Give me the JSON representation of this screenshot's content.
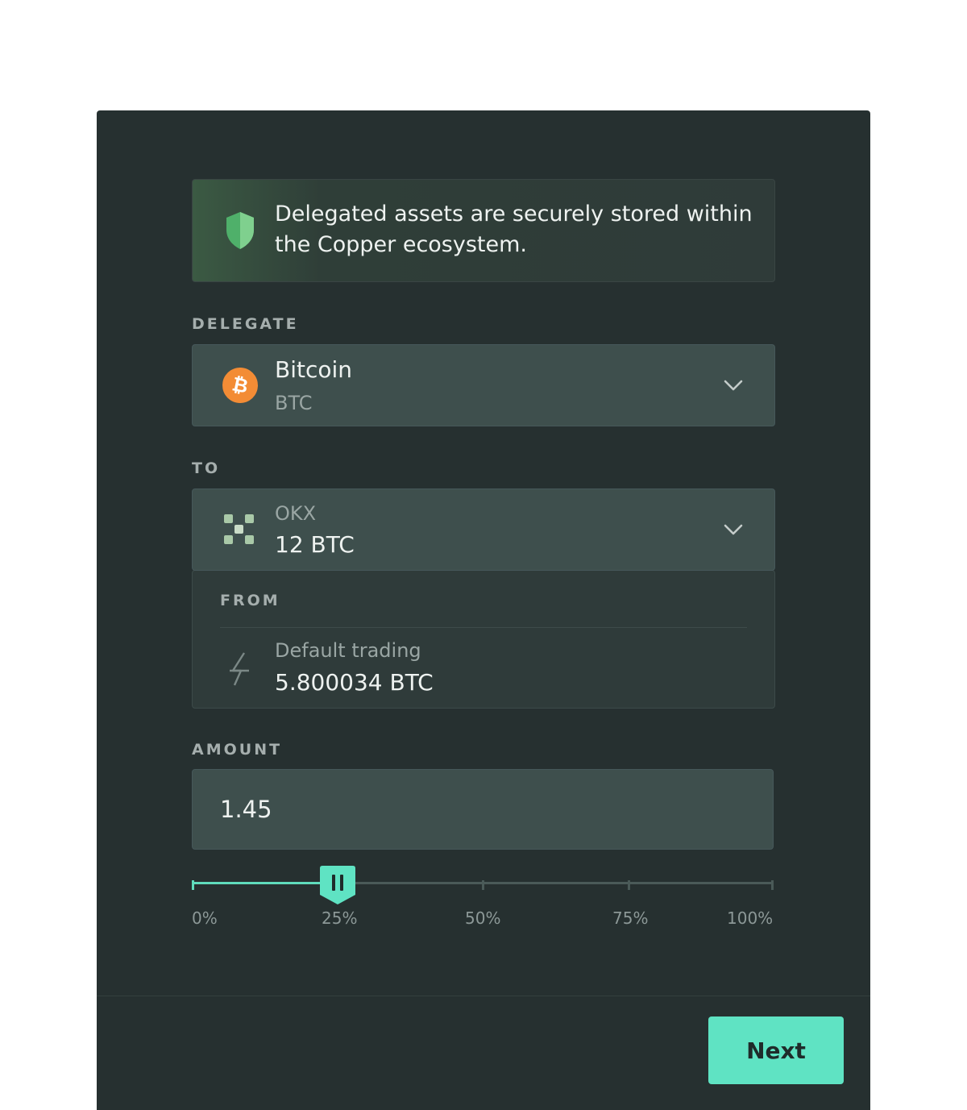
{
  "notice": {
    "text": "Delegated assets are securely stored within the Copper ecosystem.",
    "icon": "shield-icon"
  },
  "delegate": {
    "label": "DELEGATE",
    "asset_name": "Bitcoin",
    "asset_ticker": "BTC",
    "icon": "bitcoin-icon",
    "icon_glyph": "₿"
  },
  "to": {
    "label": "TO",
    "exchange_name": "OKX",
    "balance": "12 BTC",
    "icon": "okx-icon"
  },
  "from": {
    "label": "FROM",
    "account_name": "Default trading",
    "balance": "5.800034 BTC",
    "icon": "lightning-icon"
  },
  "amount": {
    "label": "AMOUNT",
    "value": "1.45"
  },
  "slider": {
    "value_percent": 25,
    "ticks": [
      "0%",
      "25%",
      "50%",
      "75%",
      "100%"
    ]
  },
  "footer": {
    "next_label": "Next"
  },
  "colors": {
    "panel_bg": "#263030",
    "accent": "#5fe3c3",
    "bitcoin": "#f38c35",
    "shield": "#4fb06a"
  }
}
